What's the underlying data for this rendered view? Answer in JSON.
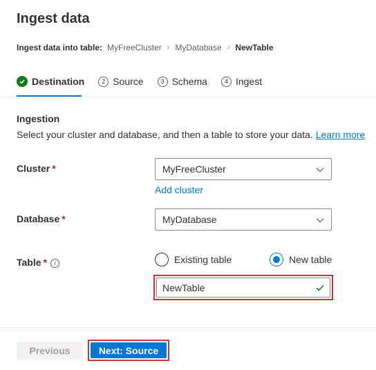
{
  "page": {
    "title": "Ingest data"
  },
  "breadcrumb": {
    "label": "Ingest data into table:",
    "items": [
      "MyFreeCluster",
      "MyDatabase"
    ],
    "current": "NewTable"
  },
  "tabs": [
    {
      "number": "",
      "label": "Destination",
      "state": "completed-active"
    },
    {
      "number": "2",
      "label": "Source",
      "state": "pending"
    },
    {
      "number": "3",
      "label": "Schema",
      "state": "pending"
    },
    {
      "number": "4",
      "label": "Ingest",
      "state": "pending"
    }
  ],
  "ingestion": {
    "title": "Ingestion",
    "description": "Select your cluster and database, and then a table to store your data.",
    "learn_more": "Learn more"
  },
  "cluster": {
    "label": "Cluster",
    "required": "*",
    "value": "MyFreeCluster",
    "add_link": "Add cluster"
  },
  "database": {
    "label": "Database",
    "required": "*",
    "value": "MyDatabase"
  },
  "table": {
    "label": "Table",
    "required": "*",
    "info_icon": "info-icon",
    "options": [
      {
        "label": "Existing table",
        "selected": false
      },
      {
        "label": "New table",
        "selected": true
      }
    ],
    "value": "NewTable"
  },
  "footer": {
    "previous_label": "Previous",
    "next_label": "Next: Source"
  },
  "colors": {
    "accent": "#0078d4",
    "success": "#107c10",
    "highlight": "#d13438",
    "required": "#a4262c"
  }
}
